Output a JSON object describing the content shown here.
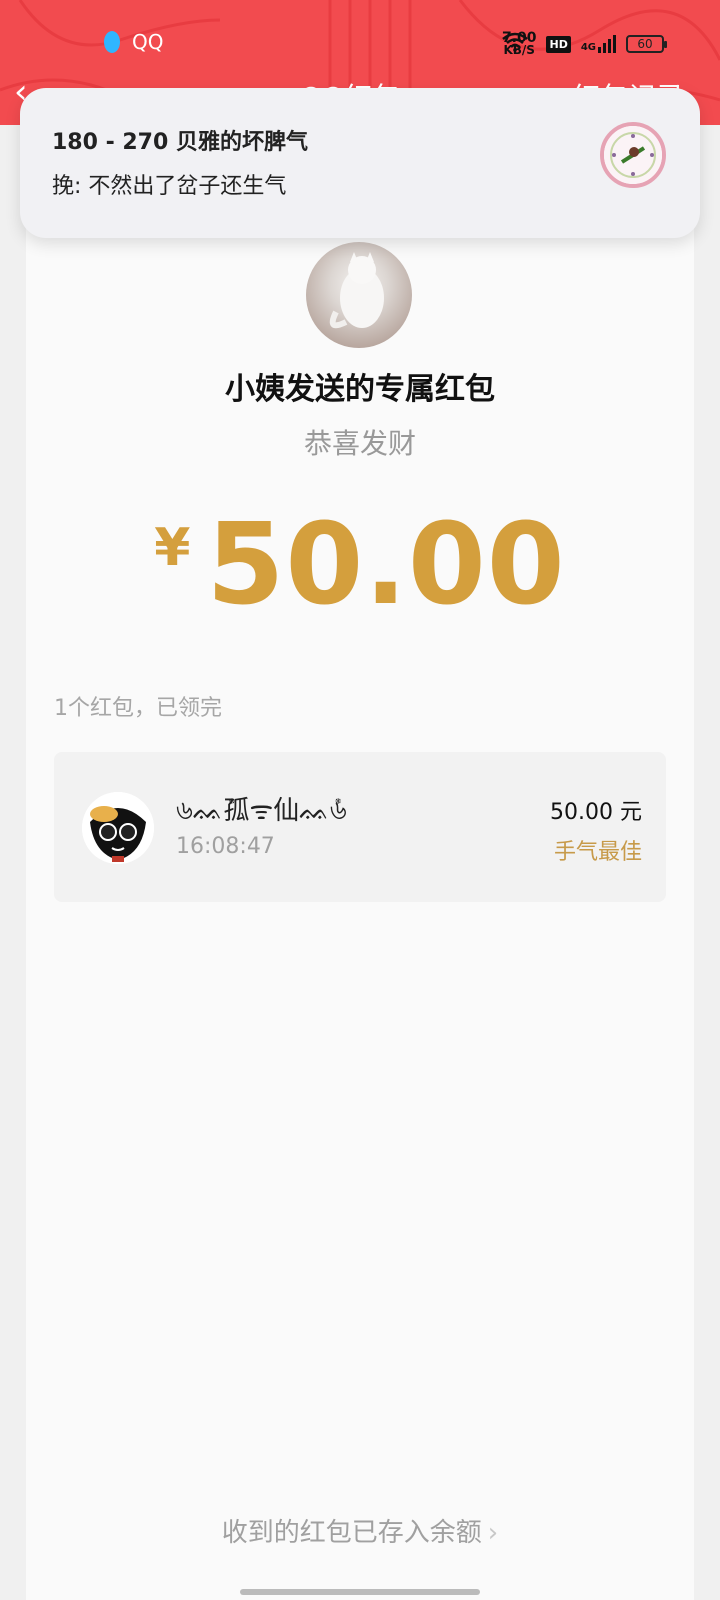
{
  "status_bar": {
    "app_name": "QQ",
    "net_speed_value": "7.00",
    "net_speed_unit": "KB/S",
    "hd_badge": "HD",
    "signal_label": "4G",
    "battery": "60"
  },
  "nav": {
    "back_icon": "chevron-left-icon",
    "title": "QQ红包",
    "record": "红包记录"
  },
  "notification": {
    "title": "180 - 270 贝雅的坏脾气",
    "message": "挽: 不然出了岔子还生气"
  },
  "packet": {
    "sender_title": "小姨发送的专属红包",
    "blessing": "恭喜发财",
    "currency_symbol": "¥",
    "amount": "50.00"
  },
  "summary": "1个红包，已领完",
  "recipients": [
    {
      "name": "৬ᨐ݊孤ᯤ仙ᨐ݊৬",
      "time": "16:08:47",
      "amount": "50.00 元",
      "badge": "手气最佳"
    }
  ],
  "footer": {
    "text": "收到的红包已存入余额",
    "chevron": "›"
  },
  "colors": {
    "header_red": "#f24b4f",
    "amount_gold": "#d49f3d",
    "best_gold": "#c79a49"
  }
}
